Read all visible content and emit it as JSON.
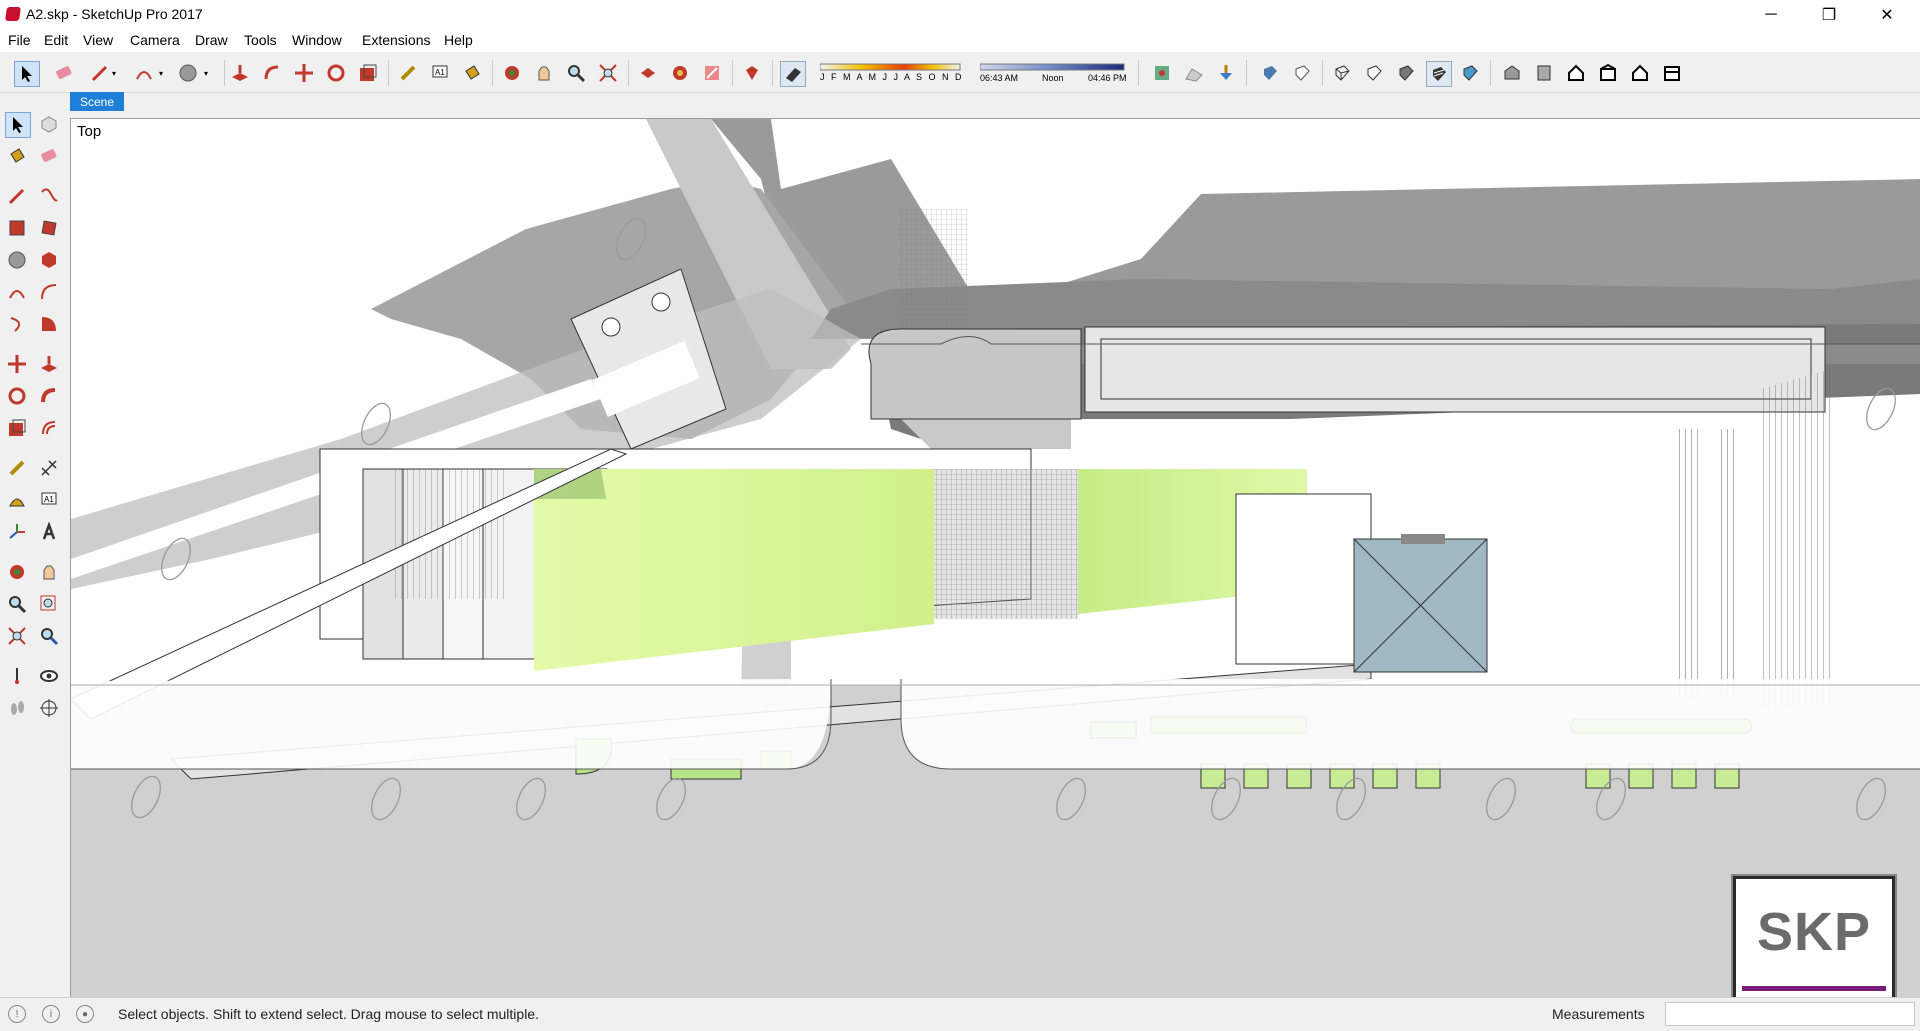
{
  "window": {
    "title": "A2.skp - SketchUp Pro 2017",
    "minimize": "─",
    "maximize": "❐",
    "close": "✕"
  },
  "menu": [
    "File",
    "Edit",
    "View",
    "Camera",
    "Draw",
    "Tools",
    "Window",
    "Extensions",
    "Help"
  ],
  "shadow_panel": {
    "months": "J F M A M J J A S O N D",
    "time_start": "06:43 AM",
    "time_mid": "Noon",
    "time_end": "04:46 PM"
  },
  "scene_tab": "Scene",
  "viewport": {
    "view_label": "Top"
  },
  "badge": {
    "text": "SKP"
  },
  "status": {
    "hint": "Select objects. Shift to extend select. Drag mouse to select multiple.",
    "measurements_label": "Measurements",
    "measurements_value": ""
  },
  "colors": {
    "accent": "#1e7fd8",
    "lawn": "#d8f5a0",
    "shadow": "#8c8c8c",
    "road": "#cfcfcf",
    "roof_blue": "#9fb8c4"
  }
}
